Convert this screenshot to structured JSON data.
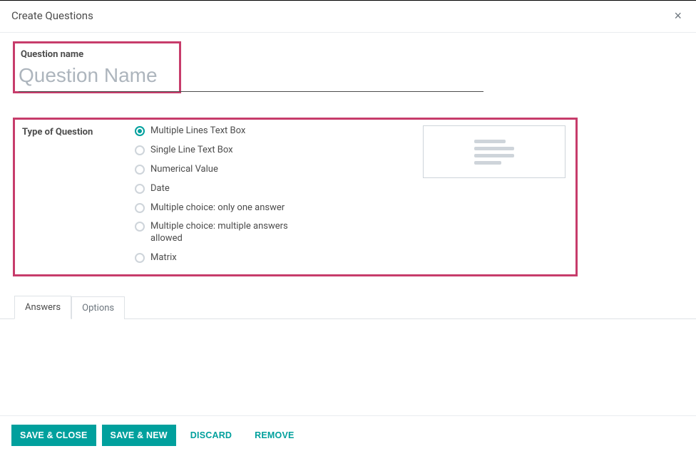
{
  "header": {
    "title": "Create Questions"
  },
  "question": {
    "name_label": "Question name",
    "name_placeholder": "Question Name",
    "name_value": ""
  },
  "type": {
    "label": "Type of Question",
    "options": [
      {
        "label": "Multiple Lines Text Box",
        "selected": true
      },
      {
        "label": "Single Line Text Box",
        "selected": false
      },
      {
        "label": "Numerical Value",
        "selected": false
      },
      {
        "label": "Date",
        "selected": false
      },
      {
        "label": "Multiple choice: only one answer",
        "selected": false
      },
      {
        "label": "Multiple choice: multiple answers allowed",
        "selected": false
      },
      {
        "label": "Matrix",
        "selected": false
      }
    ]
  },
  "tabs": [
    {
      "label": "Answers",
      "active": true
    },
    {
      "label": "Options",
      "active": false
    }
  ],
  "footer": {
    "save_close": "Save & Close",
    "save_new": "Save & New",
    "discard": "Discard",
    "remove": "Remove"
  }
}
